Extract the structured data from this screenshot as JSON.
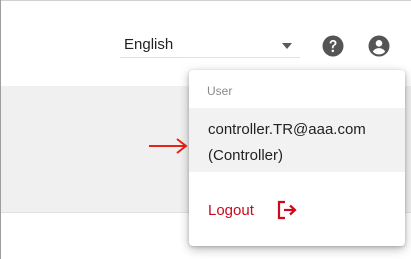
{
  "header": {
    "language": {
      "selected": "English"
    },
    "icons": {
      "help": "help-circle-icon",
      "account": "account-circle-icon"
    }
  },
  "user_menu": {
    "section_label": "User",
    "email": "controller.TR@aaa.com",
    "role": "(Controller)",
    "logout_label": "Logout",
    "logout_icon": "logout-icon"
  },
  "annotation": {
    "arrow_icon": "red-arrow-icon"
  },
  "colors": {
    "logout": "#cc0a1e",
    "arrow": "#e8231a",
    "icon_dark": "#555555",
    "highlight_bg": "#f2f2f2"
  }
}
